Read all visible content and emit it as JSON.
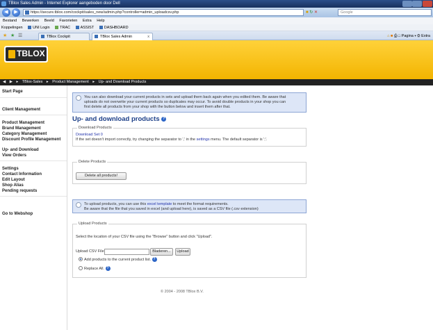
{
  "window": {
    "title": "TBlox Sales Admin - Internet Explorer aangeboden door Dell"
  },
  "address": {
    "url": "https://secure.tblox.com/cockpit/sales_new/admin.php?controller=admin_uploadcsv.php",
    "search_placeholder": "Google"
  },
  "menu": [
    "Bestand",
    "Bewerken",
    "Beeld",
    "Favorieten",
    "Extra",
    "Help"
  ],
  "links": {
    "label": "Koppelingen",
    "items": [
      "UNI Login",
      "TRAC",
      "ASSIST",
      "DASHBOARD"
    ]
  },
  "tabs": [
    {
      "label": "TBlox Cockpit"
    },
    {
      "label": "TBlox Sales Admin"
    }
  ],
  "commandbar": {
    "page": "Pagina",
    "tools": "Extra"
  },
  "logo": {
    "text": "TBLOX"
  },
  "breadcrumb": [
    "TBlox-Sales",
    "Product Management",
    "Up- and Download Products"
  ],
  "sidebar": {
    "items": [
      "Start Page",
      "Client Management",
      "Product Management",
      "Brand Management",
      "Category Management",
      "Discount Profile Management",
      "Up- and Download",
      "View Orders",
      "Settings",
      "Contact Information",
      "Edit Layout",
      "Shop Alias",
      "Pending requests",
      "Go to Webshop"
    ]
  },
  "info_top": {
    "line1": "You can also download your current products in sets and upload them back again when you edited them. Be aware that",
    "line2": "uploads do not overwrite your current products so duplicates may occur. To avoid double products in your shop you can",
    "line3": "first delete all products from your shop with the button below and insert them after that."
  },
  "page_title": "Up- and download products",
  "download": {
    "legend": "Download Products",
    "set_link": "Download Set 0",
    "note_before": "If the set doesn't import correctly, try changing the separator to ',' in the ",
    "note_link": "settings",
    "note_after": " menu. The default separator is ';'."
  },
  "delete": {
    "legend": "Delete Products",
    "button": "Delete all products!"
  },
  "info_upload": {
    "line1_before": "To upload products, you can use this ",
    "line1_link": "excel template",
    "line1_after": " to meet the format requirements.",
    "line2": "Be aware that the file that you saved in excel (and upload here), is saved as a CSV file (.csv extension)"
  },
  "upload": {
    "legend": "Upload Products",
    "instruction": "Select the location of your CSV file using the \"Browse\" button and click \"Upload\".",
    "file_label": "Upload CSV File",
    "browse_button": "Bladeren...",
    "upload_button": "Upload",
    "option_add": "Add products to the current product list.",
    "option_replace": "Replace All."
  },
  "footer": "© 2004 - 2008 TBlox B.V."
}
